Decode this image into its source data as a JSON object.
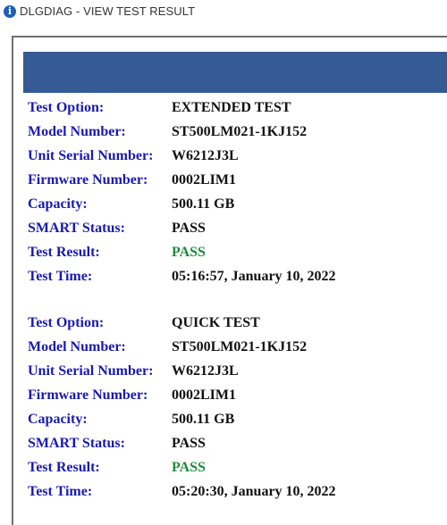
{
  "window": {
    "title": "DLGDIAG - VIEW TEST RESULT",
    "icon": "info-icon"
  },
  "colors": {
    "header_bar": "#355a94",
    "label": "#1a1ab0",
    "value": "#111111",
    "pass": "#1e8a3a"
  },
  "records": [
    {
      "test_option_label": "Test Option:",
      "test_option": "EXTENDED TEST",
      "model_number_label": "Model Number:",
      "model_number": "ST500LM021-1KJ152",
      "serial_label": "Unit Serial Number:",
      "serial": "W6212J3L",
      "firmware_label": "Firmware Number:",
      "firmware": "0002LIM1",
      "capacity_label": "Capacity:",
      "capacity": "500.11 GB",
      "smart_label": "SMART Status:",
      "smart": "PASS",
      "result_label": "Test Result:",
      "result": "PASS",
      "time_label": "Test Time:",
      "time": "05:16:57, January 10, 2022"
    },
    {
      "test_option_label": "Test Option:",
      "test_option": "QUICK TEST",
      "model_number_label": "Model Number:",
      "model_number": "ST500LM021-1KJ152",
      "serial_label": "Unit Serial Number:",
      "serial": "W6212J3L",
      "firmware_label": "Firmware Number:",
      "firmware": "0002LIM1",
      "capacity_label": "Capacity:",
      "capacity": "500.11 GB",
      "smart_label": "SMART Status:",
      "smart": "PASS",
      "result_label": "Test Result:",
      "result": "PASS",
      "time_label": "Test Time:",
      "time": "05:20:30, January 10, 2022"
    }
  ]
}
